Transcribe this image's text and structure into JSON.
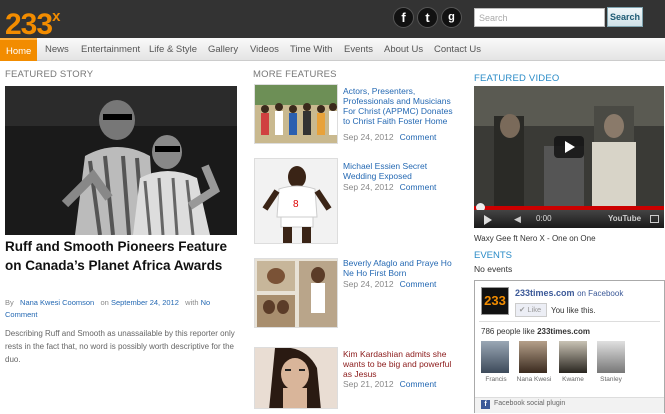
{
  "header": {
    "logo": "233",
    "logo_sup": "x",
    "social": [
      "f",
      "t",
      "g"
    ],
    "search_placeholder": "Search",
    "search_button": "Search"
  },
  "nav": [
    "Home",
    "News",
    "Entertainment",
    "Life & Style",
    "Gallery",
    "Videos",
    "Time With",
    "Events",
    "About Us",
    "Contact Us"
  ],
  "featured_story": {
    "heading": "FEATURED STORY",
    "title": "Ruff and Smooth Pioneers Feature on Canada’s Planet Africa Awards",
    "by": "By",
    "author": "Nana Kwesi Coomson",
    "on": "on",
    "date": "September 24, 2012",
    "with": "with",
    "comment_link_1": "No",
    "comment_link_2": "Comment",
    "excerpt": "Describing Ruff and Smooth as unassailable by this reporter only rests in the fact that, no word is possibly worth descriptive for the duo."
  },
  "more_features": {
    "heading": "MORE FEATURES",
    "items": [
      {
        "title": "Actors, Presenters, Professionals and Musicians For Christ (APPMC) Donates to Christ Faith Foster Home",
        "date": "Sep 24, 2012",
        "comment": "Comment"
      },
      {
        "title": "Michael Essien Secret Wedding Exposed",
        "date": "Sep 24, 2012",
        "comment": "Comment"
      },
      {
        "title": "Beverly Afaglo and Praye Ho Ne Ho First Born",
        "date": "Sep 24, 2012",
        "comment": "Comment"
      },
      {
        "title": "Kim Kardashian admits she wants to be big and powerful as Jesus",
        "date": "Sep 21, 2012",
        "comment": "Comment"
      }
    ]
  },
  "featured_video": {
    "heading": "FEATURED VIDEO",
    "time": "0:00",
    "youtube": "YouTube",
    "caption": "Waxy Gee ft Nero X - One on One"
  },
  "events": {
    "heading": "EVENTS",
    "text": "No events"
  },
  "facebook": {
    "site": "233times.com",
    "on_facebook": "on Facebook",
    "like": "Like",
    "you_like": "You like this.",
    "count_text": "786 people like",
    "site2": "233times.com",
    "people": [
      "Francis",
      "Nana Kwesi",
      "Kwame",
      "Stanley"
    ],
    "plugin": "Facebook social plugin"
  },
  "colors": {
    "accent": "#f28c00",
    "link": "#2569b3",
    "heading_blue": "#2a8bc7",
    "dark": "#333333"
  }
}
